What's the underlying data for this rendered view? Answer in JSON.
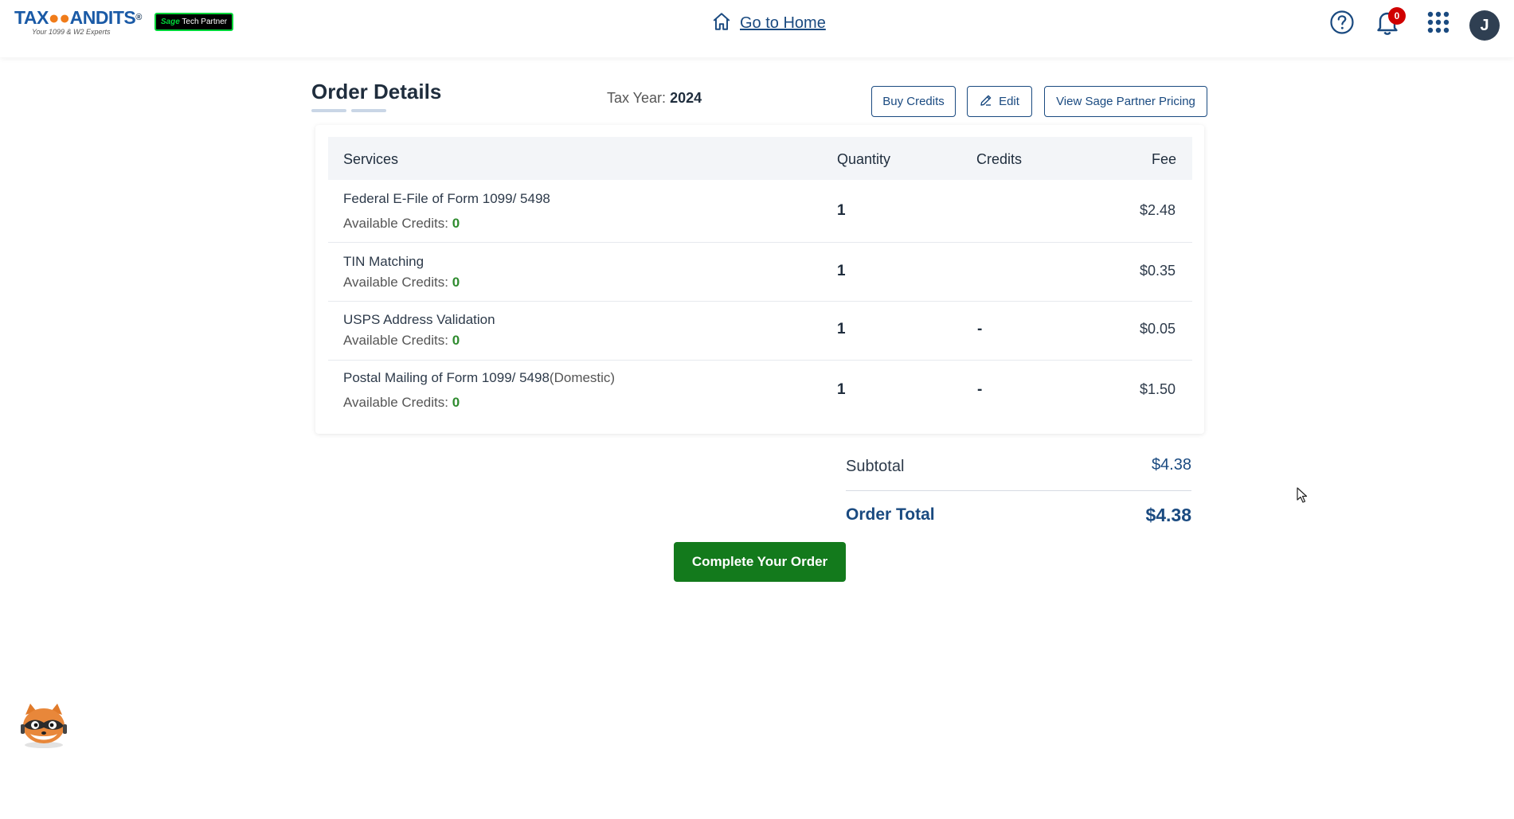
{
  "header": {
    "logo_text_a": "TAX",
    "logo_text_b": "ANDITS",
    "logo_registered": "®",
    "logo_tagline": "Your 1099 & W2 Experts",
    "partner_badge_brand": "Sage",
    "partner_badge_text": "Tech Partner",
    "home_link": "Go to Home",
    "notification_count": "0",
    "avatar_initial": "J",
    "icons": [
      "home-icon",
      "help-icon",
      "bell-icon",
      "apps-grid-icon"
    ]
  },
  "order": {
    "title": "Order Details",
    "tax_year_label": "Tax Year:",
    "tax_year_value": "2024",
    "buttons": {
      "buy_credits": "Buy Credits",
      "edit": "Edit",
      "view_pricing": "View Sage Partner Pricing"
    }
  },
  "table": {
    "columns": [
      "Services",
      "Quantity",
      "Credits",
      "Fee"
    ],
    "available_label": "Available Credits:",
    "rows": [
      {
        "service": "Federal E-File of Form 1099/ 5498",
        "suffix": "",
        "available": "0",
        "quantity": "1",
        "credits": "",
        "fee": "$2.48"
      },
      {
        "service": "TIN Matching",
        "suffix": "",
        "available": "0",
        "quantity": "1",
        "credits": "",
        "fee": "$0.35"
      },
      {
        "service": "USPS Address Validation",
        "suffix": "",
        "available": "0",
        "quantity": "1",
        "credits": "-",
        "fee": "$0.05"
      },
      {
        "service": "Postal Mailing of Form 1099/ 5498",
        "suffix": "(Domestic)",
        "available": "0",
        "quantity": "1",
        "credits": "-",
        "fee": "$1.50"
      }
    ]
  },
  "totals": {
    "subtotal_label": "Subtotal",
    "subtotal_value": "$4.38",
    "order_total_label": "Order Total",
    "order_total_value": "$4.38"
  },
  "actions": {
    "complete_order": "Complete Your Order"
  },
  "colors": {
    "brand_blue": "#1a4a80",
    "success_green": "#137a1c",
    "credit_count_green": "#2e8b2e",
    "notification_red": "#d00000",
    "sage_green": "#00d639"
  }
}
